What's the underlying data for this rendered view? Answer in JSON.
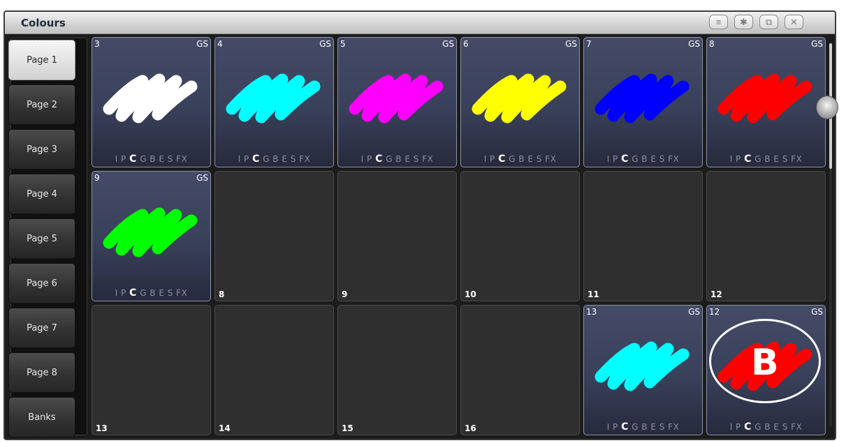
{
  "window": {
    "title": "Colours"
  },
  "title_buttons": [
    {
      "name": "menu-button",
      "icon": "menu-icon"
    },
    {
      "name": "settings-button",
      "icon": "gear-icon"
    },
    {
      "name": "resize-button",
      "icon": "resize-icon"
    },
    {
      "name": "close-button",
      "icon": "close-icon"
    }
  ],
  "pages": [
    "Page 1",
    "Page 2",
    "Page 3",
    "Page 4",
    "Page 5",
    "Page 6",
    "Page 7",
    "Page 8",
    "Banks"
  ],
  "active_page": "Page 1",
  "attrs": {
    "pre": "I P ",
    "active": "C",
    "post": " G B E S FX"
  },
  "cells": [
    {
      "num": "3",
      "gs": "GS",
      "color": "#ffffff",
      "filled": true
    },
    {
      "num": "4",
      "gs": "GS",
      "color": "#00ffff",
      "filled": true
    },
    {
      "num": "5",
      "gs": "GS",
      "color": "#ff00ff",
      "filled": true
    },
    {
      "num": "6",
      "gs": "GS",
      "color": "#ffff00",
      "filled": true
    },
    {
      "num": "7",
      "gs": "GS",
      "color": "#0000ff",
      "filled": true
    },
    {
      "num": "8",
      "gs": "GS",
      "color": "#ff0000",
      "filled": true
    },
    {
      "num": "9",
      "gs": "GS",
      "color": "#00ff00",
      "filled": true
    },
    {
      "num": "8",
      "filled": false
    },
    {
      "num": "9",
      "filled": false
    },
    {
      "num": "10",
      "filled": false
    },
    {
      "num": "11",
      "filled": false
    },
    {
      "num": "12",
      "filled": false
    },
    {
      "num": "13",
      "filled": false
    },
    {
      "num": "14",
      "filled": false
    },
    {
      "num": "15",
      "filled": false
    },
    {
      "num": "16",
      "filled": false
    },
    {
      "num": "13",
      "gs": "GS",
      "color": "#00ffff",
      "filled": true
    },
    {
      "num": "12",
      "gs": "GS",
      "color": "#ff0000",
      "filled": true
    }
  ],
  "annotation": {
    "letter": "B"
  }
}
